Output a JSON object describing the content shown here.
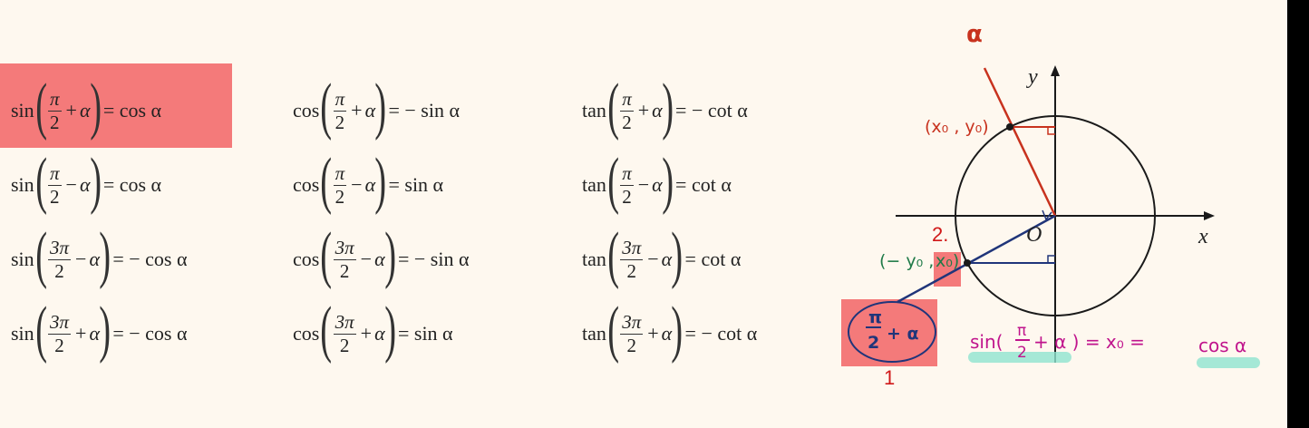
{
  "formulas": [
    {
      "fn": "sin",
      "num": "π",
      "den": "2",
      "op": "+",
      "var": "α",
      "rhs": "= cos α"
    },
    {
      "fn": "cos",
      "num": "π",
      "den": "2",
      "op": "+",
      "var": "α",
      "rhs": "= − sin α"
    },
    {
      "fn": "tan",
      "num": "π",
      "den": "2",
      "op": "+",
      "var": "α",
      "rhs": "= − cot α"
    },
    {
      "fn": "sin",
      "num": "π",
      "den": "2",
      "op": "−",
      "var": "α",
      "rhs": "= cos α"
    },
    {
      "fn": "cos",
      "num": "π",
      "den": "2",
      "op": "−",
      "var": "α",
      "rhs": "= sin α"
    },
    {
      "fn": "tan",
      "num": "π",
      "den": "2",
      "op": "−",
      "var": "α",
      "rhs": "= cot α"
    },
    {
      "fn": "sin",
      "num": "3π",
      "den": "2",
      "op": "−",
      "var": "α",
      "rhs": "= − cos α"
    },
    {
      "fn": "cos",
      "num": "3π",
      "den": "2",
      "op": "−",
      "var": "α",
      "rhs": "= − sin α"
    },
    {
      "fn": "tan",
      "num": "3π",
      "den": "2",
      "op": "−",
      "var": "α",
      "rhs": "= cot α"
    },
    {
      "fn": "sin",
      "num": "3π",
      "den": "2",
      "op": "+",
      "var": "α",
      "rhs": "= − cos α"
    },
    {
      "fn": "cos",
      "num": "3π",
      "den": "2",
      "op": "+",
      "var": "α",
      "rhs": "= sin α"
    },
    {
      "fn": "tan",
      "num": "3π",
      "den": "2",
      "op": "+",
      "var": "α",
      "rhs": "= − cot α"
    }
  ],
  "diagram": {
    "axis_y": "y",
    "axis_x": "x",
    "origin": "O",
    "alpha_label": "α",
    "point_upper": "(x₀ , y₀)",
    "point_lower_a": "(− y₀ ,",
    "point_lower_b": "x₀)",
    "angle_num": "π",
    "angle_den": "2",
    "angle_rest": "+ α",
    "eq_sin": "sin(",
    "eq_num": "π",
    "eq_den": "2",
    "eq_rest": "+ α ) = x₀ = ",
    "eq_cos": "cos α",
    "marker_1": "1",
    "marker_2": "2.",
    "colors": {
      "highlight": "#f47a7a",
      "circle": "#1a1a1a",
      "red_ink": "#c8321e",
      "blue_ink": "#20357a",
      "green_ink": "#1f7a48",
      "magenta_ink": "#c0148c",
      "teal_highlight": "#8fe3cf"
    }
  }
}
